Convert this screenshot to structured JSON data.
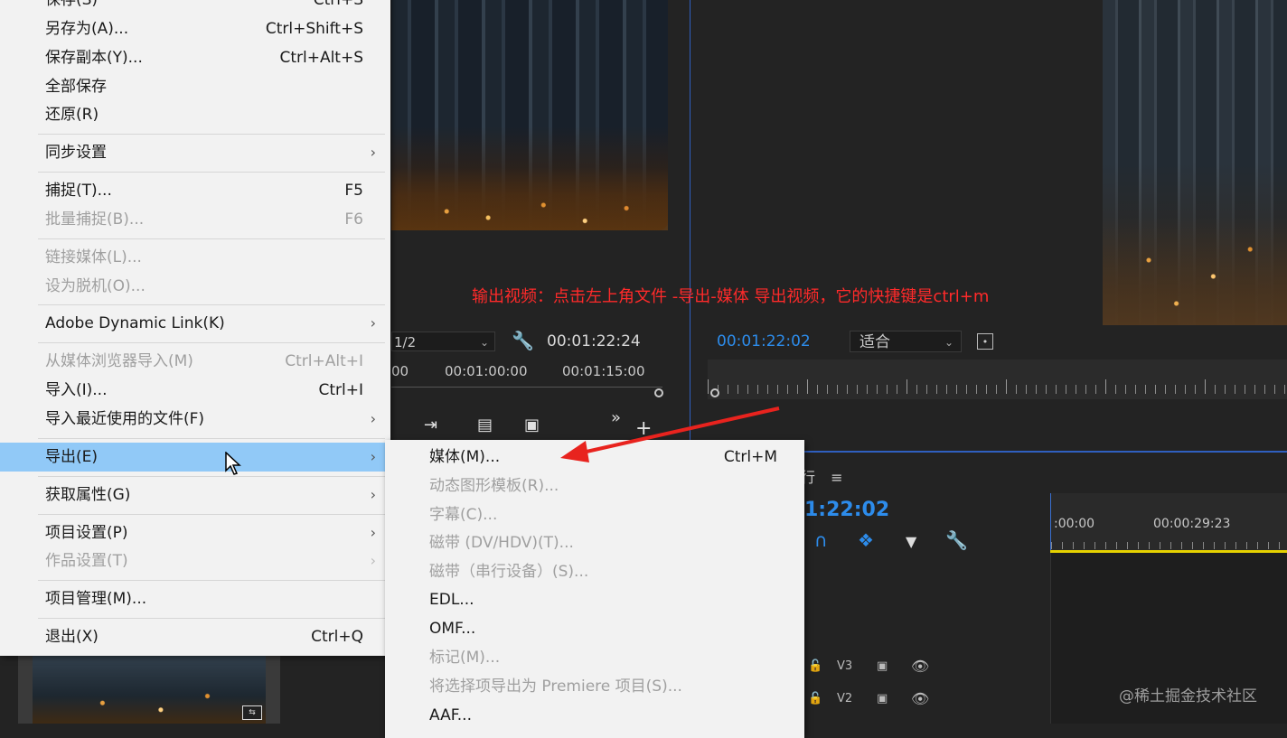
{
  "source_monitor": {
    "dropdown_value": "1/2",
    "timecode": "00:01:22:24",
    "ruler_labels": [
      "00",
      "00:01:00:00",
      "00:01:15:00"
    ]
  },
  "program_monitor": {
    "timecode": "00:01:22:02",
    "fit_value": "适合"
  },
  "annotation": "输出视频：点击左上角文件 -导出-媒体 导出视频，它的快捷键是ctrl+m",
  "timeline": {
    "tab_fragment": "行",
    "timecode": "1:22:02",
    "ruler_labels": [
      ":00:00",
      "00:00:29:23"
    ],
    "tracks": [
      {
        "name": "V3"
      },
      {
        "name": "V2"
      }
    ]
  },
  "watermark": "@稀土掘金技术社区",
  "file_menu": {
    "items": [
      {
        "label": "保存(S)",
        "shortcut": "Ctrl+S"
      },
      {
        "label": "另存为(A)...",
        "shortcut": "Ctrl+Shift+S"
      },
      {
        "label": "保存副本(Y)...",
        "shortcut": "Ctrl+Alt+S"
      },
      {
        "label": "全部保存",
        "shortcut": ""
      },
      {
        "label": "还原(R)",
        "shortcut": ""
      },
      {
        "label": "同步设置",
        "shortcut": ""
      },
      {
        "label": "捕捉(T)...",
        "shortcut": "F5"
      },
      {
        "label": "批量捕捉(B)...",
        "shortcut": "F6"
      },
      {
        "label": "链接媒体(L)...",
        "shortcut": ""
      },
      {
        "label": "设为脱机(O)...",
        "shortcut": ""
      },
      {
        "label": "Adobe Dynamic Link(K)",
        "shortcut": ""
      },
      {
        "label": "从媒体浏览器导入(M)",
        "shortcut": "Ctrl+Alt+I"
      },
      {
        "label": "导入(I)...",
        "shortcut": "Ctrl+I"
      },
      {
        "label": "导入最近使用的文件(F)",
        "shortcut": ""
      },
      {
        "label": "导出(E)",
        "shortcut": ""
      },
      {
        "label": "获取属性(G)",
        "shortcut": ""
      },
      {
        "label": "项目设置(P)",
        "shortcut": ""
      },
      {
        "label": "作品设置(T)",
        "shortcut": ""
      },
      {
        "label": "项目管理(M)...",
        "shortcut": ""
      },
      {
        "label": "退出(X)",
        "shortcut": "Ctrl+Q"
      }
    ]
  },
  "export_submenu": {
    "items": [
      {
        "label": "媒体(M)...",
        "shortcut": "Ctrl+M"
      },
      {
        "label": "动态图形模板(R)...",
        "shortcut": ""
      },
      {
        "label": "字幕(C)...",
        "shortcut": ""
      },
      {
        "label": "磁带 (DV/HDV)(T)...",
        "shortcut": ""
      },
      {
        "label": "磁带（串行设备）(S)...",
        "shortcut": ""
      },
      {
        "label": "EDL...",
        "shortcut": ""
      },
      {
        "label": "OMF...",
        "shortcut": ""
      },
      {
        "label": "标记(M)...",
        "shortcut": ""
      },
      {
        "label": "将选择项导出为 Premiere 项目(S)...",
        "shortcut": ""
      },
      {
        "label": "AAF...",
        "shortcut": ""
      }
    ]
  },
  "colors": {
    "menu_bg": "#f2f2f2",
    "menu_highlight": "#91c9f7",
    "timecode_blue": "#2d8ceb",
    "annotation_red": "#ff2a2a",
    "timeline_yellow": "#e6d200"
  },
  "icons": [
    "wrench-icon",
    "chevron-right-icon",
    "mouse-cursor-icon",
    "eye-icon",
    "lock-icon",
    "magnet-icon",
    "marker-icon"
  ]
}
